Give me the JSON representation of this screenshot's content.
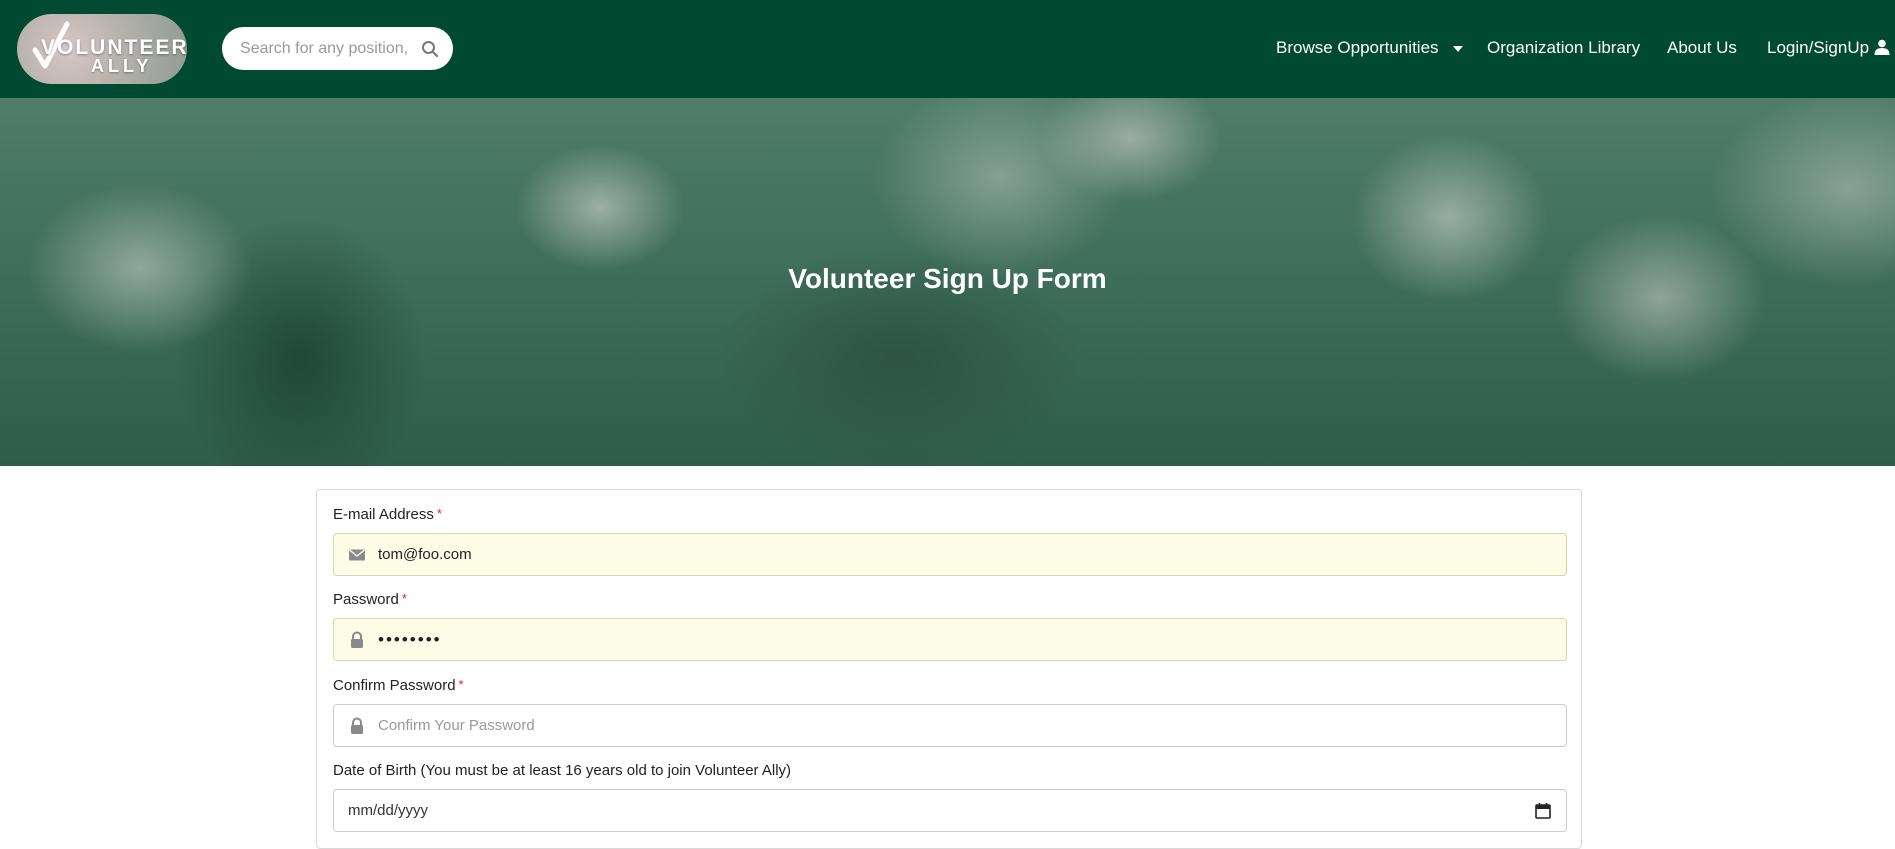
{
  "brand": {
    "logo_line1": "VOLUNTEER",
    "logo_line2": "ALLY"
  },
  "search": {
    "placeholder": "Search for any position, location"
  },
  "nav": {
    "browse": "Browse Opportunities",
    "library": "Organization Library",
    "about": "About Us",
    "login": "Login/SignUp"
  },
  "hero": {
    "title": "Volunteer Sign Up Form"
  },
  "form": {
    "email": {
      "label": "E-mail Address",
      "required_mark": "*",
      "value": "tom@foo.com",
      "icon": "envelope-icon"
    },
    "password": {
      "label": "Password",
      "required_mark": "*",
      "value": "••••••••",
      "icon": "lock-icon"
    },
    "confirm_password": {
      "label": "Confirm Password",
      "required_mark": "*",
      "placeholder": "Confirm Your Password",
      "icon": "lock-icon"
    },
    "dob": {
      "label": "Date of Birth (You must be at least 16 years old to join Volunteer Ally)",
      "placeholder": "mm/dd/yyyy",
      "icon": "calendar-icon"
    }
  },
  "colors": {
    "navbar": "#004a32",
    "required": "#d12a2a",
    "autofill": "#fdfde7"
  }
}
